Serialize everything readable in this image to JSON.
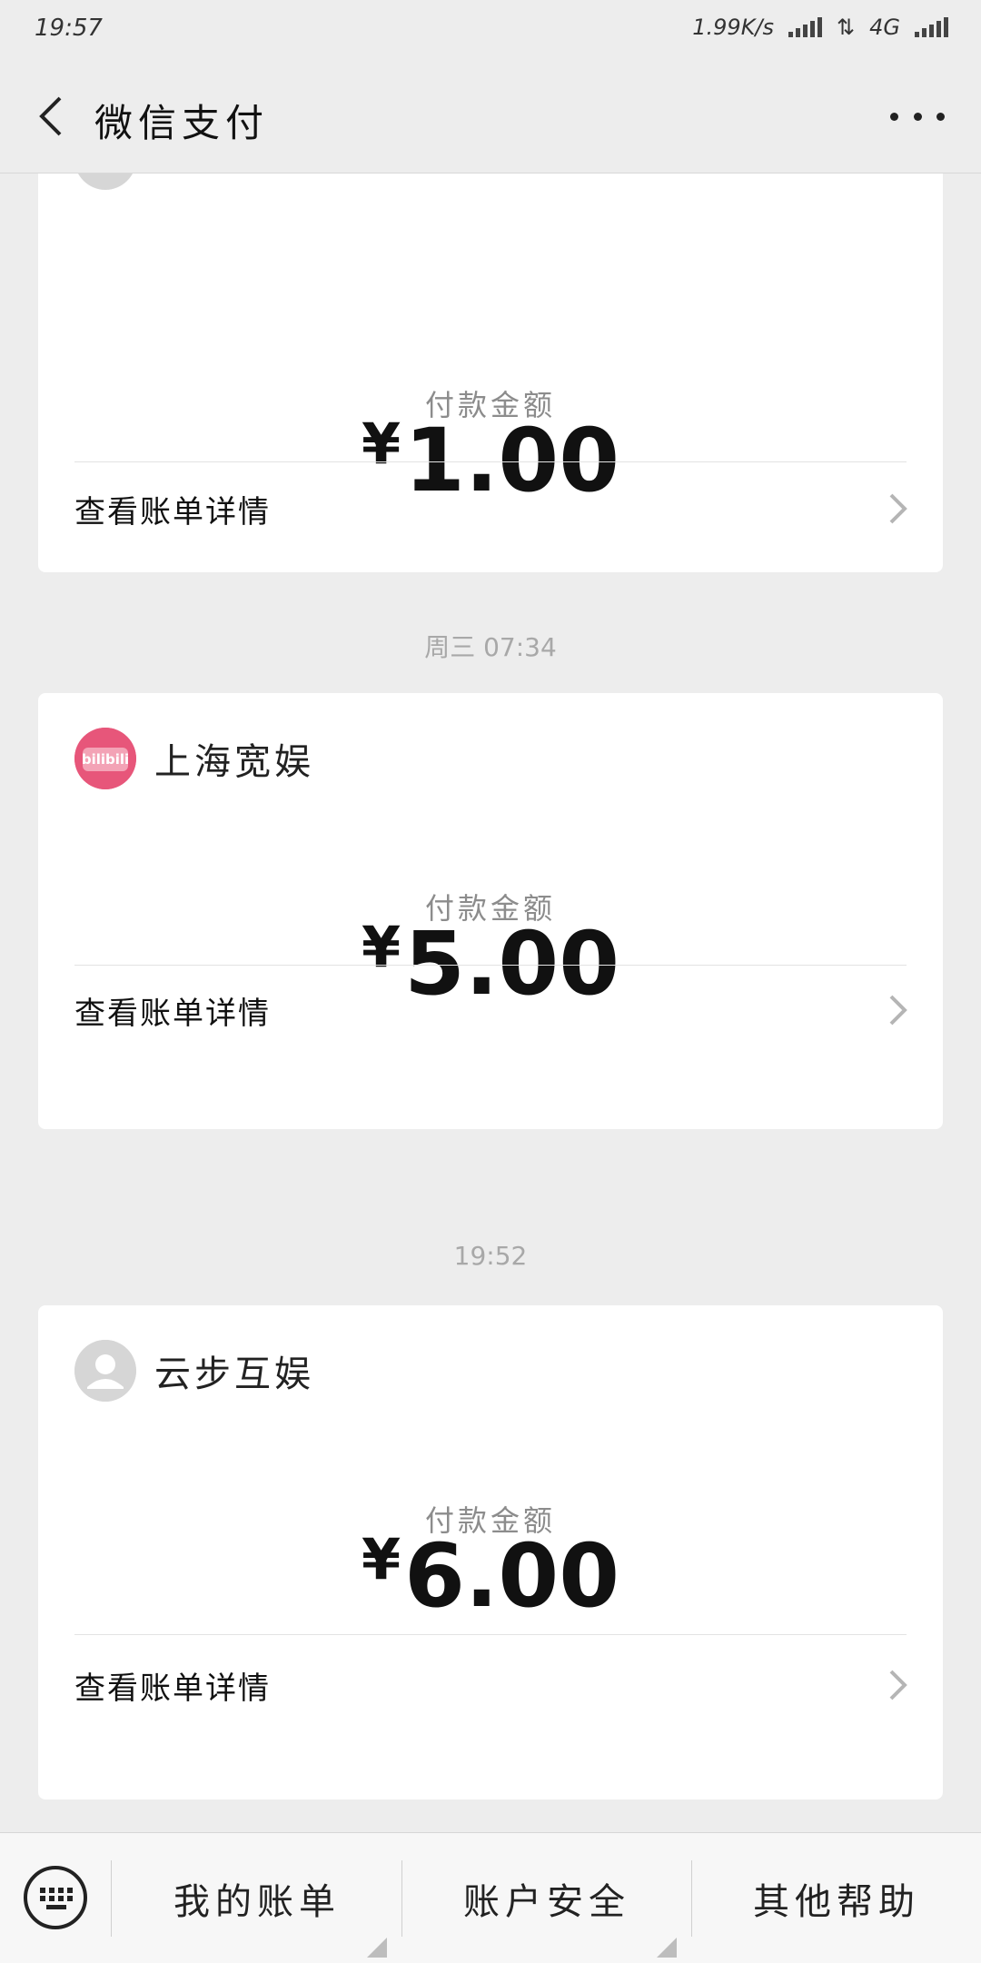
{
  "status_bar": {
    "time": "19:57",
    "net_speed": "1.99K/s",
    "network": "4G"
  },
  "header": {
    "title": "微信支付"
  },
  "cards": [
    {
      "merchant": "",
      "amount_label": "付款金额",
      "currency": "¥",
      "amount": "1.00",
      "detail_label": "查看账单详情"
    },
    {
      "merchant": "上海宽娱",
      "logo_text": "bilibili",
      "amount_label": "付款金额",
      "currency": "¥",
      "amount": "5.00",
      "detail_label": "查看账单详情"
    },
    {
      "merchant": "云步互娱",
      "amount_label": "付款金额",
      "currency": "¥",
      "amount": "6.00",
      "detail_label": "查看账单详情"
    }
  ],
  "timestamps": [
    "周三 07:34",
    "19:52"
  ],
  "bottom_menu": {
    "items": [
      "我的账单",
      "账户安全",
      "其他帮助"
    ]
  },
  "colors": {
    "progress": "#1aad19",
    "bilibili_pink": "#e7567a"
  }
}
